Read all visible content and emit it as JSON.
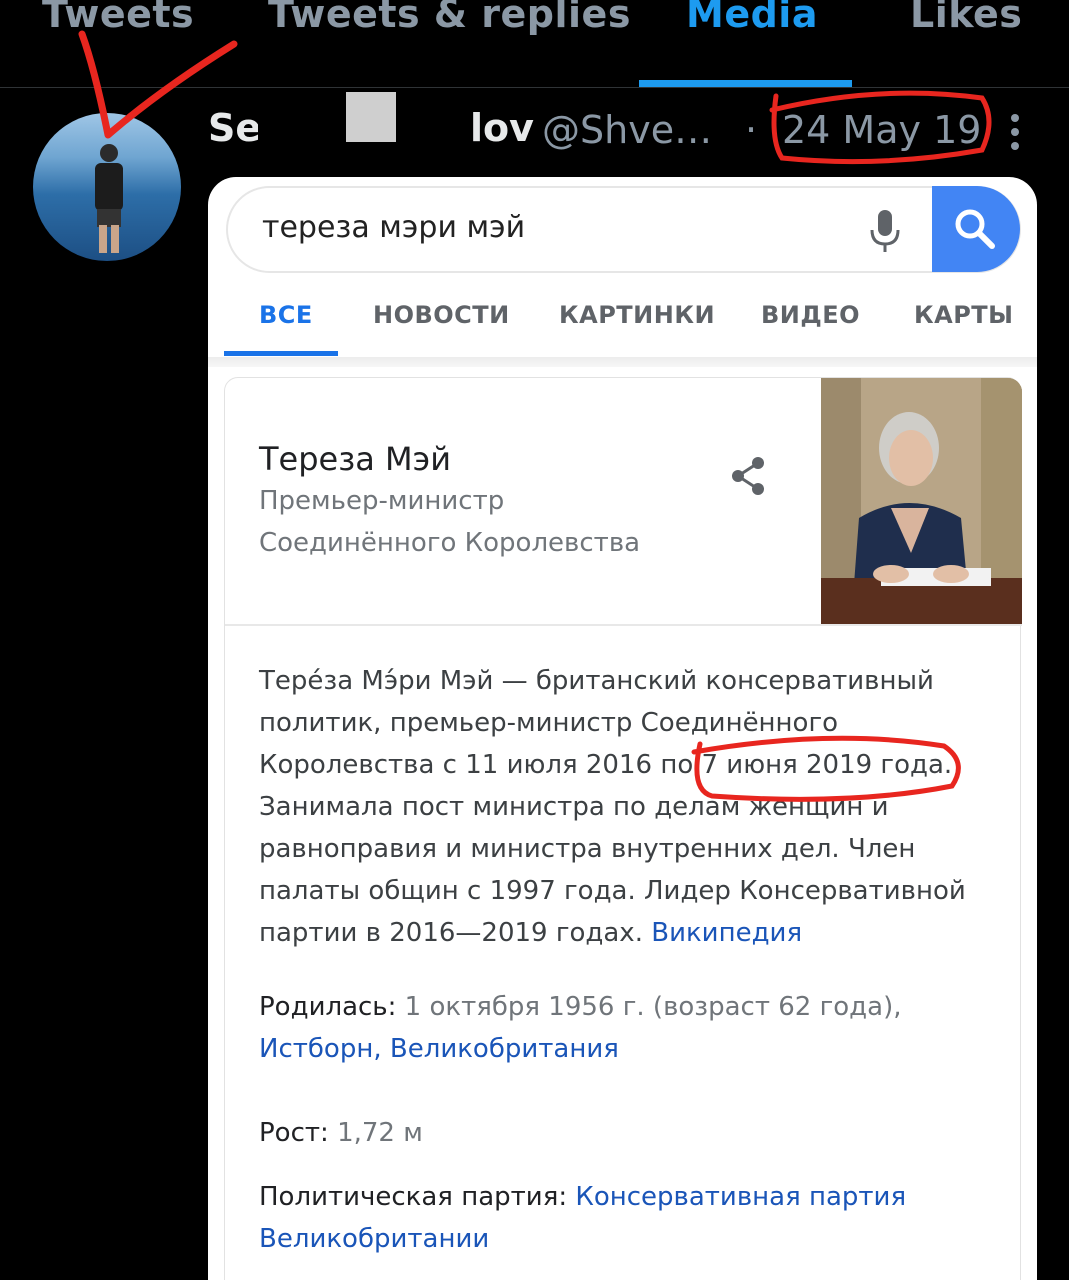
{
  "tabs": [
    {
      "label": "Tweets"
    },
    {
      "label": "Tweets & replies"
    },
    {
      "label": "Media"
    },
    {
      "label": "Likes"
    }
  ],
  "tweet": {
    "name_start": "Se",
    "name_end": "lov",
    "handle": "@Shve…",
    "separator": "·",
    "date": "24 May 19"
  },
  "search": {
    "query": "тереза мэри мэй"
  },
  "google_tabs": [
    {
      "label": "ВСЕ"
    },
    {
      "label": "НОВОСТИ"
    },
    {
      "label": "КАРТИНКИ"
    },
    {
      "label": "ВИДЕО"
    },
    {
      "label": "КАРТЫ"
    }
  ],
  "knowledge_panel": {
    "title": "Тереза Мэй",
    "subtitle_line1": "Премьер-министр",
    "subtitle_line2": "Соединённого Королевства",
    "desc_lines": [
      "Тере́за Мэ́ри Мэй — британский консервативный",
      "политик, премьер-министр Соединённого",
      "Королевства с 11 июля 2016 по 7 июня 2019 года.",
      "Занимала пост министра по делам женщин и",
      "равноправия и министра внутренних дел. Член",
      "палаты общин с 1997 года. Лидер Консервативной",
      "партии в 2016—2019 годах."
    ],
    "desc_link": "Википедия",
    "born_label": "Родилась:",
    "born_value": "1 октября 1956 г. (возраст 62 года),",
    "born_place": "Истборн, Великобритания",
    "height_label": "Рост:",
    "height_value": "1,72 м",
    "party_label": "Политическая партия:",
    "party_value_line1": "Консервативная партия",
    "party_value_line2": "Великобритании"
  },
  "colors": {
    "twitter_blue": "#1d9bf0",
    "google_blue": "#4285f4",
    "annotation_red": "#e8261f"
  },
  "icons": [
    "more-vertical-icon",
    "microphone-icon",
    "search-icon",
    "share-icon"
  ]
}
